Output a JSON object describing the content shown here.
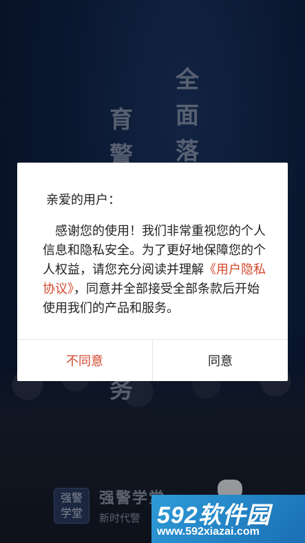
{
  "background": {
    "calligraphy_right": [
      "全",
      "面",
      "落"
    ],
    "calligraphy_left": [
      "育",
      "警"
    ],
    "calligraphy_bottom": "务"
  },
  "brand": {
    "logo_text": "强警学堂",
    "name": "强警学堂",
    "slogan": "新时代警"
  },
  "dialog": {
    "greeting": "亲爱的用户：",
    "body_before_link": "感谢您的使用！我们非常重视您的个人信息和隐私安全。为了更好地保障您的个人权益，请您充分阅读并理解",
    "link_text": "《用户隐私协议》",
    "body_after_link": "，同意并全部接受全部条款后开始使用我们的产品和服务。",
    "disagree_label": "不同意",
    "agree_label": "同意",
    "accent_color": "#d2472b"
  },
  "watermark": {
    "title": "592软件园",
    "url": "www.592xiazai.com"
  }
}
